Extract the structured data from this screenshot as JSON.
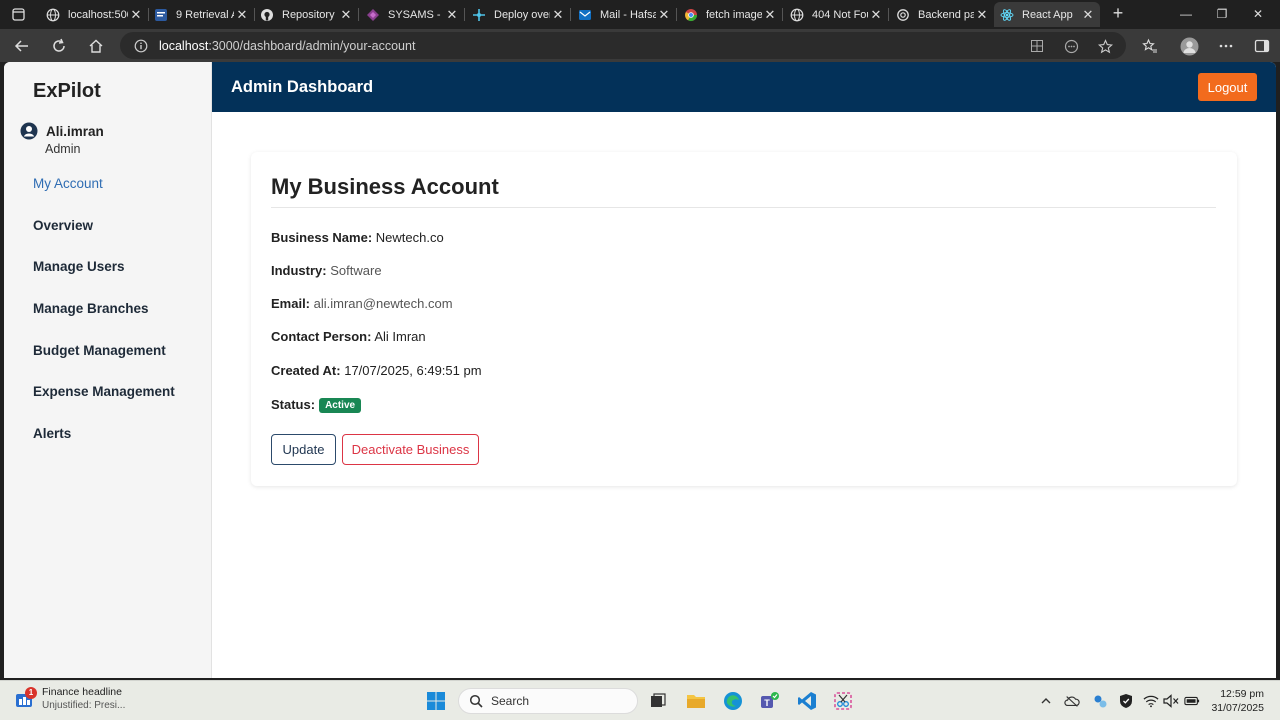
{
  "browser": {
    "tabs": [
      {
        "title": "localhost:500",
        "icon": "globe-icon"
      },
      {
        "title": "9 Retrieval A",
        "icon": "doc-icon"
      },
      {
        "title": "Repository s",
        "icon": "github-icon"
      },
      {
        "title": "SYSAMS - P",
        "icon": "power-apps-icon"
      },
      {
        "title": "Deploy over",
        "icon": "deploy-icon"
      },
      {
        "title": "Mail - Hafsa",
        "icon": "outlook-icon"
      },
      {
        "title": "fetch image",
        "icon": "chrome-icon"
      },
      {
        "title": "404 Not Fou",
        "icon": "globe-icon"
      },
      {
        "title": "Backend pa",
        "icon": "openai-icon"
      },
      {
        "title": "React App",
        "icon": "react-icon"
      }
    ],
    "url_host": "localhost",
    "url_rest": ":3000/dashboard/admin/your-account"
  },
  "app": {
    "brand": "ExPilot",
    "user": {
      "name": "Ali.imran",
      "role": "Admin"
    },
    "nav": [
      {
        "label": "My Account",
        "active": true
      },
      {
        "label": "Overview"
      },
      {
        "label": "Manage Users"
      },
      {
        "label": "Manage Branches"
      },
      {
        "label": "Budget Management"
      },
      {
        "label": "Expense Management"
      },
      {
        "label": "Alerts"
      }
    ],
    "header_title": "Admin Dashboard",
    "logout_label": "Logout"
  },
  "account": {
    "title": "My Business Account",
    "fields": [
      {
        "label": "Business Name:",
        "value": "Newtech.co"
      },
      {
        "label": "Industry:",
        "value": "Software"
      },
      {
        "label": "Email:",
        "value": "ali.imran@newtech.com"
      },
      {
        "label": "Contact Person:",
        "value": "Ali Imran"
      },
      {
        "label": "Created At:",
        "value": "17/07/2025, 6:49:51 pm"
      }
    ],
    "status_label": "Status:",
    "status_value": "Active",
    "update_label": "Update",
    "deactivate_label": "Deactivate Business"
  },
  "taskbar": {
    "news_badge": "1",
    "news_title": "Finance headline",
    "news_sub": "Unjustified: Presi...",
    "search_label": "Search",
    "time": "12:59 pm",
    "date": "31/07/2025"
  },
  "colors": {
    "header_bg": "#033159",
    "logout_bg": "#f26b1d",
    "active_nav": "#2f6db3",
    "status_badge": "#198754",
    "danger": "#dc3545"
  }
}
